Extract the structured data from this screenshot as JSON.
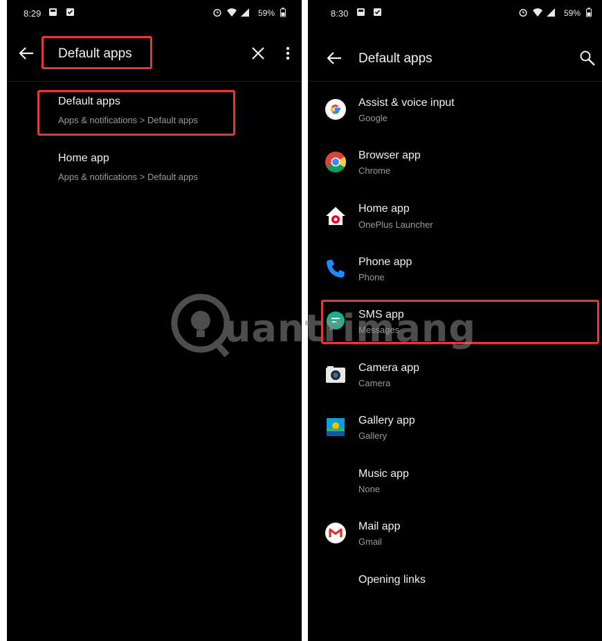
{
  "left": {
    "status": {
      "time": "8:29",
      "battery": "59%"
    },
    "search": {
      "query": "Default apps"
    },
    "results": [
      {
        "title": "Default apps",
        "path": "Apps & notifications > Default apps"
      },
      {
        "title": "Home app",
        "path": "Apps & notifications > Default apps"
      }
    ]
  },
  "right": {
    "status": {
      "time": "8:30",
      "battery": "59%"
    },
    "title": "Default apps",
    "items": [
      {
        "title": "Assist & voice input",
        "subtitle": "Google",
        "icon": "google-icon"
      },
      {
        "title": "Browser app",
        "subtitle": "Chrome",
        "icon": "chrome-icon"
      },
      {
        "title": "Home app",
        "subtitle": "OnePlus Launcher",
        "icon": "home-icon"
      },
      {
        "title": "Phone app",
        "subtitle": "Phone",
        "icon": "phone-icon"
      },
      {
        "title": "SMS app",
        "subtitle": "Messages",
        "icon": "messages-icon"
      },
      {
        "title": "Camera app",
        "subtitle": "Camera",
        "icon": "camera-icon"
      },
      {
        "title": "Gallery app",
        "subtitle": "Gallery",
        "icon": "gallery-icon"
      },
      {
        "title": "Music app",
        "subtitle": "None",
        "icon": ""
      },
      {
        "title": "Mail app",
        "subtitle": "Gmail",
        "icon": "gmail-icon"
      },
      {
        "title": "Opening links",
        "subtitle": "",
        "icon": ""
      }
    ]
  },
  "watermark": {
    "text": "uantrimang"
  },
  "colors": {
    "highlight": "#e53935",
    "background": "#000000"
  }
}
